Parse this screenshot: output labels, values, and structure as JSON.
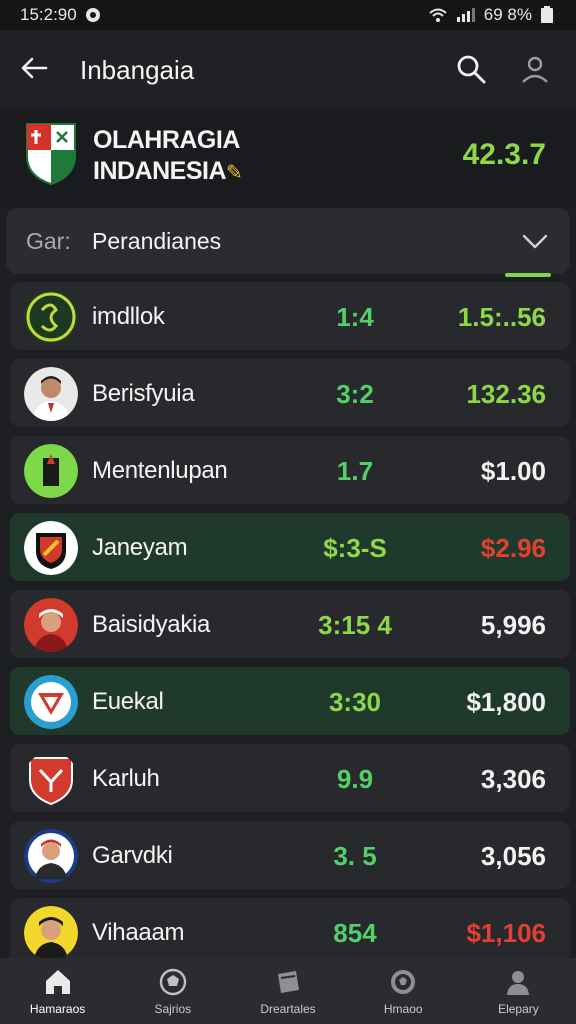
{
  "status_bar": {
    "time": "15:2:90",
    "right_text": "69 8%"
  },
  "app_bar": {
    "title": "Inbangaia"
  },
  "league": {
    "name_line1": "OLAHRAGIA",
    "name_line2": "INDANESIA",
    "value": "42.3.7"
  },
  "dropdown": {
    "prefix": "Gar:",
    "label": "Perandianes"
  },
  "rows": [
    {
      "name": "imdllok",
      "score": "1:4",
      "price": "1.5:..56",
      "price_color": "green",
      "highlight": false
    },
    {
      "name": "Berisfyuia",
      "score": "3:2",
      "price": "132.36",
      "price_color": "green",
      "highlight": false
    },
    {
      "name": "Mentenlupan",
      "score": "1.7",
      "price": "$1.00",
      "price_color": "white",
      "highlight": false
    },
    {
      "name": "Janeyam",
      "score": "$:3-S",
      "price": "$2.96",
      "price_color": "red",
      "highlight": true
    },
    {
      "name": "Baisidyakia",
      "score": "3:15 4",
      "price": "5,996",
      "price_color": "white",
      "highlight": false
    },
    {
      "name": "Euekal",
      "score": "3:30",
      "price": "$1,800",
      "price_color": "white",
      "highlight": true
    },
    {
      "name": "Karluh",
      "score": "9.9",
      "price": "3,306",
      "price_color": "white",
      "highlight": false
    },
    {
      "name": "Garvdki",
      "score": "3. 5",
      "price": "3,056",
      "price_color": "white",
      "highlight": false
    },
    {
      "name": "Vihaaam",
      "score": "854",
      "price": "$1,106",
      "price_color": "red",
      "highlight": false
    }
  ],
  "bottom_nav": [
    {
      "label": "Hamaraos",
      "icon": "home-icon"
    },
    {
      "label": "Sajrios",
      "icon": "ball-icon"
    },
    {
      "label": "Dreartales",
      "icon": "card-icon"
    },
    {
      "label": "Hmaoo",
      "icon": "soccer-icon"
    },
    {
      "label": "Elepary",
      "icon": "person-icon"
    }
  ],
  "colors": {
    "accent_green": "#8ed848",
    "score_green": "#53d168",
    "red": "#e24032",
    "background": "#1d1f22"
  }
}
